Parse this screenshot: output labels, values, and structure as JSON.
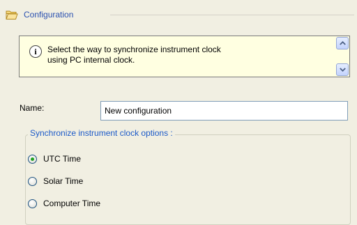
{
  "header": {
    "title": "Configuration",
    "icon": "folder-open-icon"
  },
  "info": {
    "icon": "info-icon",
    "icon_glyph": "i",
    "line1": "Select the way to synchronize instrument clock",
    "line2": "using PC internal clock."
  },
  "form": {
    "name_label": "Name:",
    "name_value": "New configuration"
  },
  "sync_options": {
    "legend": "Synchronize instrument clock options :",
    "selected": "UTC Time",
    "options": [
      {
        "label": "UTC Time",
        "checked": true
      },
      {
        "label": "Solar Time",
        "checked": false
      },
      {
        "label": "Computer Time",
        "checked": false
      }
    ]
  },
  "colors": {
    "background": "#f1efe2",
    "header_text": "#2a50b0",
    "legend_text": "#1c5ac8",
    "info_background": "#ffffe1",
    "radio_dot": "#21a121"
  }
}
